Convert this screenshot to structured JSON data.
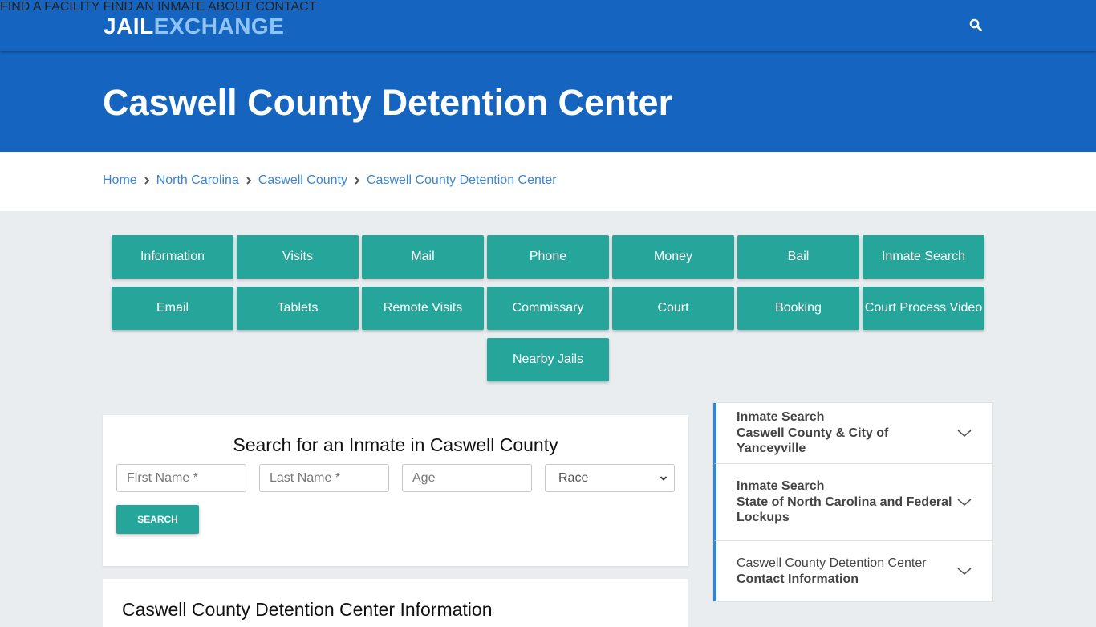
{
  "header": {
    "logo_part1": "JAIL",
    "logo_part2": "EXCHANGE",
    "nav": [
      {
        "label": "FIND A FACILITY"
      },
      {
        "label": "FIND AN INMATE"
      },
      {
        "label": "ABOUT"
      },
      {
        "label": "CONTACT"
      }
    ],
    "search_icon": "search-icon",
    "colors": {
      "bar": "#1565c0",
      "logo_accent": "#8fc4f2"
    }
  },
  "hero": {
    "title": "Caswell County Detention Center"
  },
  "breadcrumb": [
    {
      "label": "Home"
    },
    {
      "label": "North Carolina"
    },
    {
      "label": "Caswell County"
    },
    {
      "label": "Caswell County Detention Center"
    }
  ],
  "tiles": [
    {
      "label": "Information"
    },
    {
      "label": "Visits"
    },
    {
      "label": "Mail"
    },
    {
      "label": "Phone"
    },
    {
      "label": "Money"
    },
    {
      "label": "Bail"
    },
    {
      "label": "Inmate Search"
    },
    {
      "label": "Email"
    },
    {
      "label": "Tablets"
    },
    {
      "label": "Remote Visits"
    },
    {
      "label": "Commissary"
    },
    {
      "label": "Court"
    },
    {
      "label": "Booking"
    },
    {
      "label": "Court Process Video"
    },
    {
      "label": "Nearby Jails"
    }
  ],
  "tile_color": "#26a69a",
  "search": {
    "title": "Search for an Inmate in Caswell County",
    "first_name_placeholder": "First Name *",
    "last_name_placeholder": "Last Name *",
    "age_placeholder": "Age",
    "race_selected": "Race",
    "button_label": "SEARCH"
  },
  "info_section": {
    "title": "Caswell County Detention Center Information"
  },
  "accordion": [
    {
      "line1": "Inmate Search",
      "line2": "Caswell County & City of Yanceyville",
      "line1_bold": true
    },
    {
      "line1": "Inmate Search",
      "line2": "State of North Carolina and Federal Lockups",
      "line1_bold": true
    },
    {
      "line1": "Caswell County Detention Center",
      "line2": "Contact Information",
      "line1_bold": false
    }
  ]
}
